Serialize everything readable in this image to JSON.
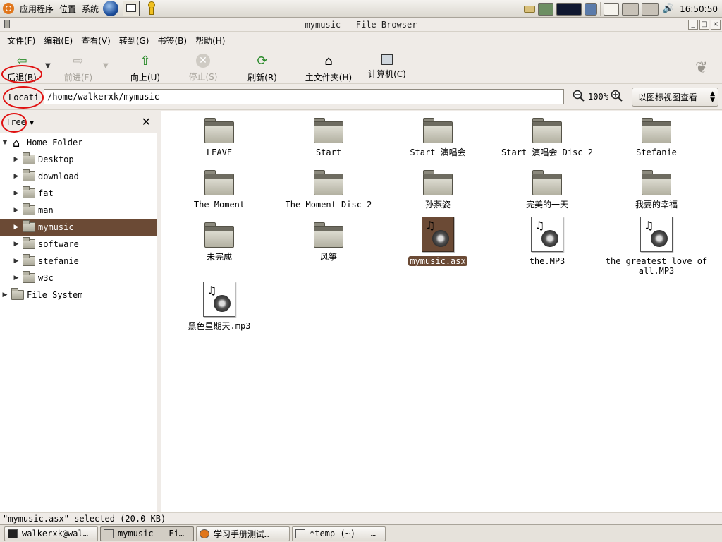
{
  "top_panel": {
    "menus": [
      "应用程序",
      "位置",
      "系统"
    ],
    "clock": "16:50:50"
  },
  "window": {
    "title": "mymusic - File Browser"
  },
  "menubar": [
    "文件(F)",
    "编辑(E)",
    "查看(V)",
    "转到(G)",
    "书签(B)",
    "帮助(H)"
  ],
  "toolbar": {
    "back": "后退(B)",
    "forward": "前进(F)",
    "up": "向上(U)",
    "stop": "停止(S)",
    "reload": "刷新(R)",
    "home": "主文件夹(H)",
    "computer": "计算机(C)"
  },
  "location": {
    "label": "Locati",
    "path": "/home/walkerxk/mymusic",
    "zoom": "100%",
    "view_mode": "以图标视图查看"
  },
  "sidebar": {
    "type": "Tree",
    "items": [
      {
        "label": "Home Folder",
        "level": 0,
        "expanded": true,
        "selected": false,
        "icon": "home-icon"
      },
      {
        "label": "Desktop",
        "level": 1,
        "expanded": false,
        "selected": false,
        "icon": "folder-icon"
      },
      {
        "label": "download",
        "level": 1,
        "expanded": false,
        "selected": false,
        "icon": "folder-icon"
      },
      {
        "label": "fat",
        "level": 1,
        "expanded": false,
        "selected": false,
        "icon": "folder-icon"
      },
      {
        "label": "man",
        "level": 1,
        "expanded": false,
        "selected": false,
        "icon": "folder-icon"
      },
      {
        "label": "mymusic",
        "level": 1,
        "expanded": false,
        "selected": true,
        "icon": "folder-icon"
      },
      {
        "label": "software",
        "level": 1,
        "expanded": false,
        "selected": false,
        "icon": "folder-icon"
      },
      {
        "label": "stefanie",
        "level": 1,
        "expanded": false,
        "selected": false,
        "icon": "folder-icon"
      },
      {
        "label": "w3c",
        "level": 1,
        "expanded": false,
        "selected": false,
        "icon": "folder-icon"
      },
      {
        "label": "File System",
        "level": 0,
        "expanded": false,
        "selected": false,
        "icon": "folder-icon"
      }
    ]
  },
  "files": [
    {
      "name": "LEAVE",
      "type": "folder",
      "selected": false
    },
    {
      "name": "Start",
      "type": "folder",
      "selected": false
    },
    {
      "name": "Start 演唱会",
      "type": "folder",
      "selected": false
    },
    {
      "name": "Start 演唱会 Disc 2",
      "type": "folder",
      "selected": false
    },
    {
      "name": "Stefanie",
      "type": "folder",
      "selected": false
    },
    {
      "name": "The Moment",
      "type": "folder",
      "selected": false
    },
    {
      "name": "The Moment Disc 2",
      "type": "folder",
      "selected": false
    },
    {
      "name": "孙燕姿",
      "type": "folder",
      "selected": false
    },
    {
      "name": "完美的一天",
      "type": "folder",
      "selected": false
    },
    {
      "name": "我要的幸福",
      "type": "folder",
      "selected": false
    },
    {
      "name": "未完成",
      "type": "folder",
      "selected": false
    },
    {
      "name": "风筝",
      "type": "folder",
      "selected": false
    },
    {
      "name": "mymusic.asx",
      "type": "audio",
      "selected": true
    },
    {
      "name": "the.MP3",
      "type": "audio",
      "selected": false
    },
    {
      "name": "the greatest love of all.MP3",
      "type": "audio",
      "selected": false
    },
    {
      "name": "黑色星期天.mp3",
      "type": "audio",
      "selected": false
    }
  ],
  "status": "\"mymusic.asx\" selected (20.0 KB)",
  "taskbar": [
    {
      "label": "walkerxk@wal…",
      "active": false,
      "icon": "terminal-icon"
    },
    {
      "label": "mymusic - Fi…",
      "active": true,
      "icon": "file-browser-icon"
    },
    {
      "label": "学习手册测试…",
      "active": false,
      "icon": "firefox-icon"
    },
    {
      "label": "*temp (~) - …",
      "active": false,
      "icon": "text-editor-icon"
    }
  ],
  "colors": {
    "selection": "#6b4a35",
    "annotation": "#e01010",
    "panel_bg": "#efebe7"
  }
}
